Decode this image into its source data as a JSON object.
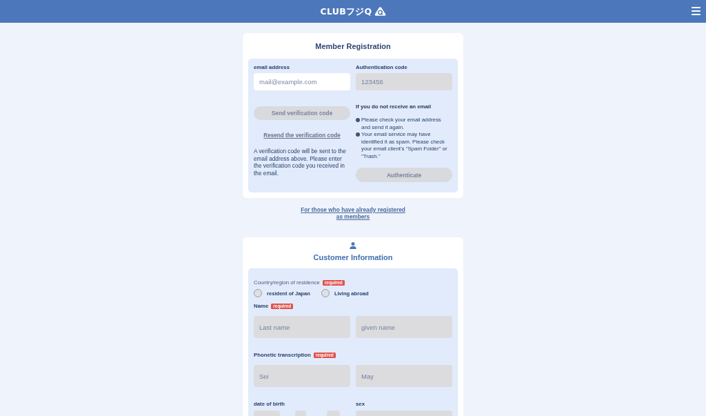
{
  "header": {
    "logo": "CLUBフジQ"
  },
  "registration": {
    "title": "Member Registration",
    "email": {
      "label": "email address",
      "placeholder": "mail@example.com",
      "disabled": false
    },
    "auth_code": {
      "label": "Authentication code",
      "placeholder": "123456",
      "disabled": true
    },
    "send_button": {
      "label": "Send verification code",
      "disabled": true
    },
    "resend_link": "Resend the verification code",
    "note": "A verification code will be sent to the email address above. Please enter the verification code you received in the email.",
    "help": {
      "title": "If you do not receive an email",
      "items": [
        "Please check your email address and send it again.",
        "Your email service may have identified it as spam. Please check your email client's \"Spam Folder\" or \"Trash.\""
      ]
    },
    "authenticate_button": {
      "label": "Authenticate",
      "disabled": true
    }
  },
  "member_link": "For those who have already registered as members",
  "customer": {
    "title": "Customer Information",
    "residence": {
      "label": "Country/region of residence",
      "badge": "required",
      "options": [
        {
          "label": "resident of Japan",
          "selected": false
        },
        {
          "label": "Living abroad",
          "selected": false
        }
      ]
    },
    "name": {
      "label": "Name",
      "badge": "required",
      "fields": [
        {
          "placeholder": "Last name",
          "disabled": true
        },
        {
          "placeholder": "given name",
          "disabled": true
        }
      ]
    },
    "phonetic": {
      "label": "Phonetic transcription",
      "badge": "required",
      "fields": [
        {
          "placeholder": "Sei",
          "disabled": true
        },
        {
          "placeholder": "May",
          "disabled": true
        }
      ]
    },
    "date_of_birth": {
      "label": "date of birth",
      "fields": [
        {
          "kind": "year",
          "disabled": true
        },
        {
          "kind": "month",
          "disabled": true
        },
        {
          "kind": "day",
          "disabled": true
        }
      ]
    },
    "sex": {
      "label": "sex",
      "field": {
        "kind": "select",
        "disabled": true
      }
    }
  }
}
